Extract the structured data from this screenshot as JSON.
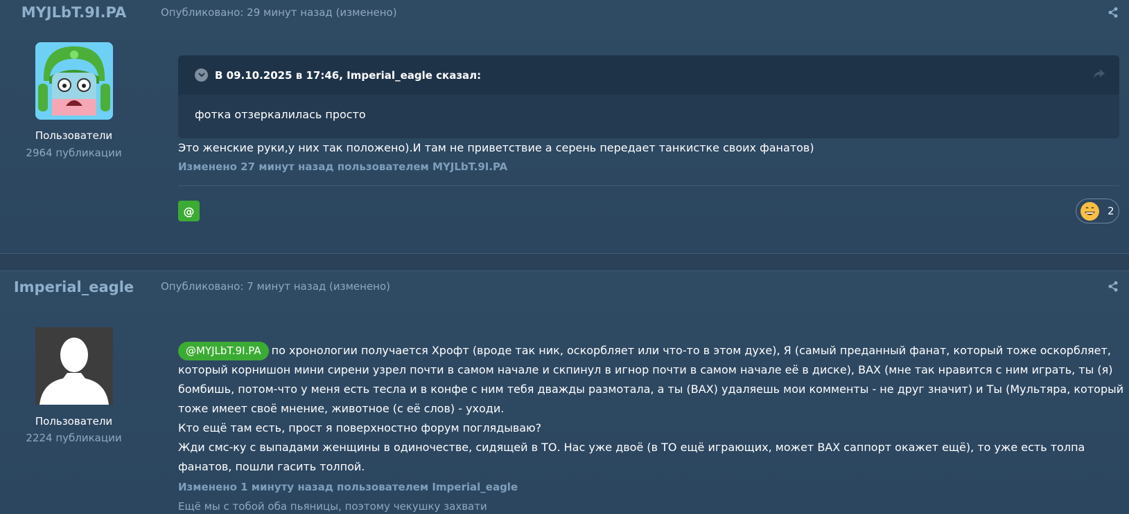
{
  "posts": [
    {
      "author": "MYJLbT.9I.PA",
      "group": "Пользователи",
      "post_count": "2964 публикации",
      "date": "Опубликовано: 29 минут назад (изменено)",
      "quote": {
        "citation": "В 09.10.2025 в 17:46, Imperial_eagle сказал:",
        "text": "фотка отзеркалилась просто"
      },
      "text": "Это женские руки,у них так положено).И там не приветствие а серень передает танкистке своих фанатов)",
      "edited": "Изменено 27 минут назад пользователем MYJLbT.9I.PA",
      "mention_button": "@",
      "reaction_count": "2"
    },
    {
      "author": "Imperial_eagle",
      "group": "Пользователи",
      "post_count": "2224 публикации",
      "date": "Опубликовано: 7 минут назад (изменено)",
      "mention": "@MYJLbT.9I.PA",
      "lines": [
        "по хронологии получается Хрофт (вроде так ник, оскорбляет или что-то в этом духе), Я (самый преданный фанат, который тоже оскорбляет,",
        "который корнишон мини сирени узрел почти в самом начале и скпинул  в игнор почти в самом начале её в диске), ВАХ (мне так нравится с ним играть, ты (я)",
        "бомбишь, потом-что у меня есть тесла и  в конфе с ним тебя дважды размотала, а ты (ВАХ)  удаляешь мои комменты - не друг значит) и Ты (Мультяра, который",
        "тоже имеет своё мнение, животное (с её слов) - уходи.",
        "Кто ещё там есть, прост я поверхностно форум поглядываю?",
        "Жди смс-ку с выпадами женщины в одиночестве, сидящей в ТО. Нас уже двоё (в ТО ещё играющих, может ВАХ саппорт окажет ещё), то уже есть толпа",
        "фанатов, пошли гасить толпой."
      ],
      "edited": "Изменено 1 минуту назад пользователем Imperial_eagle",
      "signature": "Ещё мы с тобой оба пьяницы, поэтому чекушку захвати"
    }
  ],
  "colors": {
    "background": "#2f4a63",
    "accent_green": "#3cab34",
    "muted_text": "#8fa9bf",
    "author_blue": "#8fb0cc"
  },
  "icons": {
    "share": "share-icon",
    "quote_toggle": "chevron-down-icon",
    "quote_jump": "arrow-share-icon",
    "reaction": "grinning-face-icon"
  }
}
